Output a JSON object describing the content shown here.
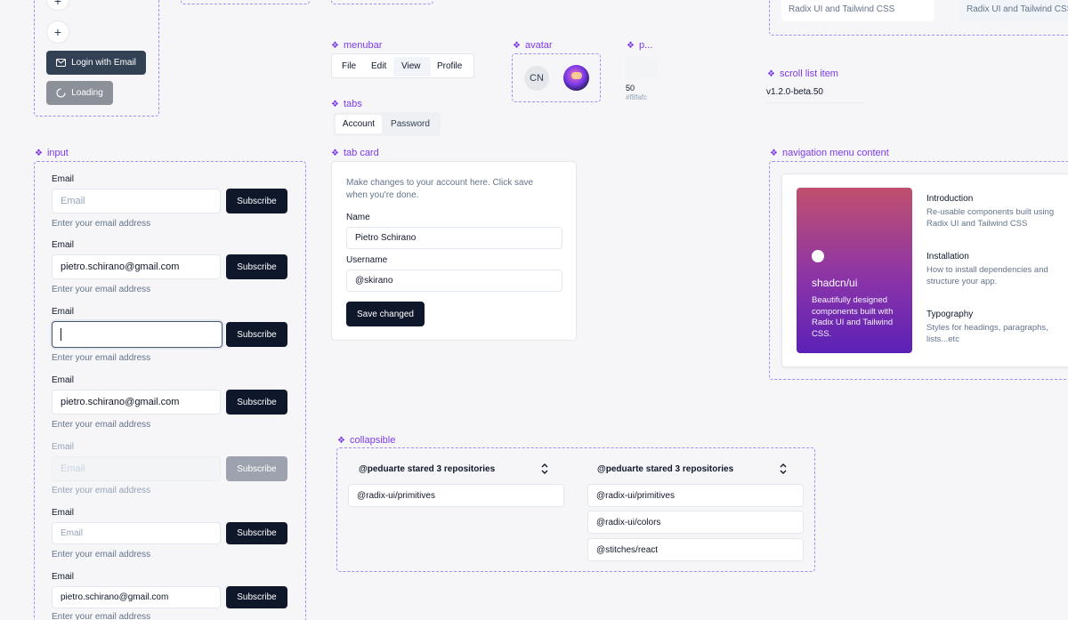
{
  "buttons_frame": {
    "plus_icon_top": "+",
    "plus_icon": "+",
    "login_label": "Login with Email",
    "loading_label": "Loading"
  },
  "menubar": {
    "label": "menubar",
    "items": [
      "File",
      "Edit",
      "View",
      "Profile"
    ]
  },
  "avatar": {
    "label": "avatar",
    "initials": "CN"
  },
  "progress_frame": {
    "label": "p...",
    "value": "50",
    "color_text": "#f8fafc"
  },
  "scroll_list": {
    "label": "scroll list item",
    "item": "v1.2.0-beta.50"
  },
  "top_right": {
    "text1": "Radix UI and Tailwind CSS",
    "text2": "Radix UI and Tailwind CSS"
  },
  "tabs": {
    "label": "tabs",
    "items": [
      "Account",
      "Password"
    ]
  },
  "input_frame": {
    "label": "input",
    "rows": [
      {
        "label": "Email",
        "value": "Email",
        "button": "Subscribe",
        "help": "Enter your email address"
      },
      {
        "label": "Email",
        "value": "pietro.schirano@gmail.com",
        "button": "Subscribe",
        "help": "Enter your email address"
      },
      {
        "label": "Email",
        "value": "",
        "button": "Subscribe",
        "help": "Enter your email address"
      },
      {
        "label": "Email",
        "value": "pietro.schirano@gmail.com",
        "button": "Subscribe",
        "help": "Enter your email address"
      },
      {
        "label": "Email",
        "value": "Email",
        "button": "Subscribe",
        "help": "Enter your email address"
      },
      {
        "label": "Email",
        "value": "Email",
        "button": "Subscribe",
        "help": "Enter your email address"
      },
      {
        "label": "Email",
        "value": "pietro.schirano@gmail.com",
        "button": "Subscribe",
        "help": "Enter your email address"
      }
    ]
  },
  "tab_card": {
    "label": "tab card",
    "description": "Make changes to your account here. Click save when you're done.",
    "name_label": "Name",
    "name_value": "Pietro Schirano",
    "username_label": "Username",
    "username_value": "@skirano",
    "save_label": "Save changed"
  },
  "nav_menu": {
    "label": "navigation menu content",
    "brand_title": "shadcn/ui",
    "brand_desc": "Beautifully designed components built with Radix UI and Tailwind CSS.",
    "items": [
      {
        "title": "Introduction",
        "desc": "Re-usable components built using Radix UI and Tailwind CSS"
      },
      {
        "title": "Installation",
        "desc": "How to install dependencies and structure your app."
      },
      {
        "title": "Typography",
        "desc": "Styles for headings, paragraphs, lists...etc"
      }
    ]
  },
  "collapsible": {
    "label": "collapsible",
    "left_title": "@peduarte stared 3 repositories",
    "left_items": [
      "@radix-ui/primitives"
    ],
    "right_title": "@peduarte stared 3 repositories",
    "right_items": [
      "@radix-ui/primitives",
      "@radix-ui/colors",
      "@stitches/react"
    ]
  }
}
